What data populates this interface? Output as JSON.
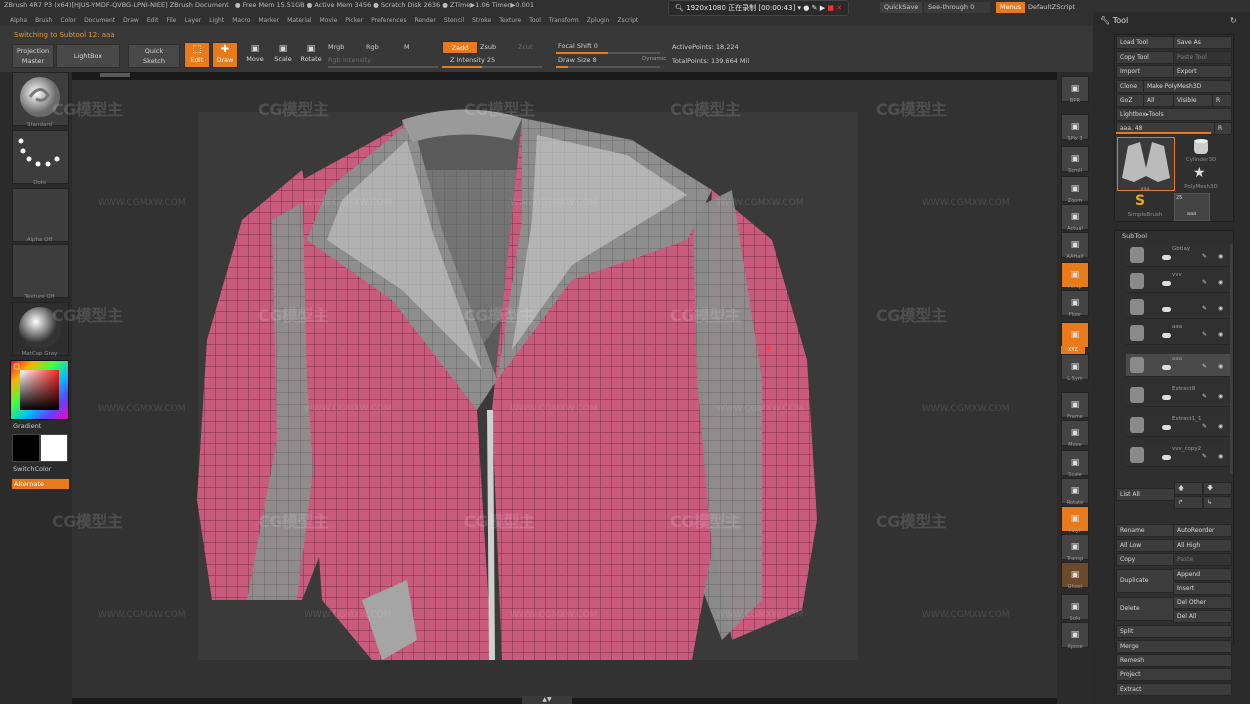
{
  "titlebar": {
    "title": "ZBrush 4R7 P3 (x64)[HJUS-YMDF-QVBG-LPNI-NIEE]   ZBrush Document",
    "stats": "● Free Mem 15.51GB ● Active Mem 3456 ● Scratch Disk 2636 ● ZTime▶1.06 Timer▶0.001",
    "recorder": "1920x1080  正在录制 [00:00:43]",
    "quicksave": "QuickSave",
    "see_through": "See-through  0",
    "menus": "Menus",
    "script": "DefaultZScript"
  },
  "menu_items": [
    "Alpha",
    "Brush",
    "Color",
    "Document",
    "Draw",
    "Edit",
    "File",
    "Layer",
    "Light",
    "Macro",
    "Marker",
    "Material",
    "Movie",
    "Picker",
    "Preferences",
    "Render",
    "Stencil",
    "Stroke",
    "Texture",
    "Tool",
    "Transform",
    "Zplugin",
    "Zscript"
  ],
  "toolbar": {
    "status_message": "Switching to Subtool 12:  aaa",
    "projection_master": "Projection\nMaster",
    "lightbox": "LightBox",
    "quick_sketch": "Quick\nSketch",
    "edit": "Edit",
    "draw": "Draw",
    "move": "Move",
    "scale": "Scale",
    "rotate": "Rotate",
    "mrgb": "Mrgb",
    "rgb": "Rgb",
    "m": "M",
    "rgb_intensity": "Rgb Intensity",
    "zadd": "Zadd",
    "zsub": "Zsub",
    "zcut": "Zcut",
    "z_intensity": "Z Intensity 25",
    "focal_shift": "Focal Shift 0",
    "draw_size": "Draw Size 8",
    "dynamic": "Dynamic",
    "active_points": "ActivePoints: 18,224",
    "total_points": "TotalPoints: 139.664 Mil"
  },
  "left_shelf": {
    "brush_label": "Standard",
    "stroke_label": "Dots",
    "alpha_label": "Alpha Off",
    "texture_label": "Texture Off",
    "material_label": "MatCap Gray",
    "gradient_label": "Gradient",
    "switch_color": "SwitchColor",
    "alternate": "Alternate"
  },
  "watermark": {
    "logo": "CG模型主",
    "url": "WWW.CGMXW.COM"
  },
  "right_shelf": [
    "BPR",
    "SPix 3",
    "Scroll",
    "Zoom",
    "Actual",
    "AAHalf",
    "Persp",
    "Floor",
    "Local",
    "L.Sym",
    "Frame",
    "Move",
    "Scale",
    "Rotate",
    "PolyF",
    "Transp",
    "Ghost",
    "Solo",
    "Xpose"
  ],
  "right_shelf_xyz": "XYZ",
  "tool_panel": {
    "title": "Tool",
    "load_tool": "Load Tool",
    "save_as": "Save As",
    "copy_tool": "Copy Tool",
    "paste_tool": "Paste Tool",
    "import": "Import",
    "export": "Export",
    "clone": "Clone",
    "make_polymesh": "Make PolyMesh3D",
    "goz": "GoZ",
    "all": "All",
    "visible": "Visible",
    "r": "R",
    "lightbox_tools": "Lightbox▸Tools",
    "aaa_slider": "aaa. 48",
    "thumbs": [
      "aaa",
      "Cylinder3D",
      "PolyMesh3D",
      "SimpleBrush",
      "aaa"
    ],
    "thumb_count": "25",
    "subtool_header": "SubTool",
    "subtools": [
      "Gbtlay",
      "vvv",
      "",
      "aaa",
      "aaa",
      "Extract8",
      "Extract1_1",
      "vvv_copy2"
    ],
    "list_all": "List All",
    "rename": "Rename",
    "auto_reorder": "AutoReorder",
    "all_low": "All Low",
    "all_high": "All High",
    "copy": "Copy",
    "paste": "Paste",
    "duplicate": "Duplicate",
    "append": "Append",
    "insert": "Insert",
    "delete": "Delete",
    "del_other": "Del Other",
    "del_all": "Del All",
    "split": "Split",
    "merge": "Merge",
    "remesh": "Remesh",
    "project": "Project",
    "extract": "Extract"
  },
  "colors": {
    "accent": "#e97a1c",
    "jacket_pink": "#c95b7f",
    "jacket_gray": "#8e8e8e",
    "panel": "#2a2a2a"
  }
}
